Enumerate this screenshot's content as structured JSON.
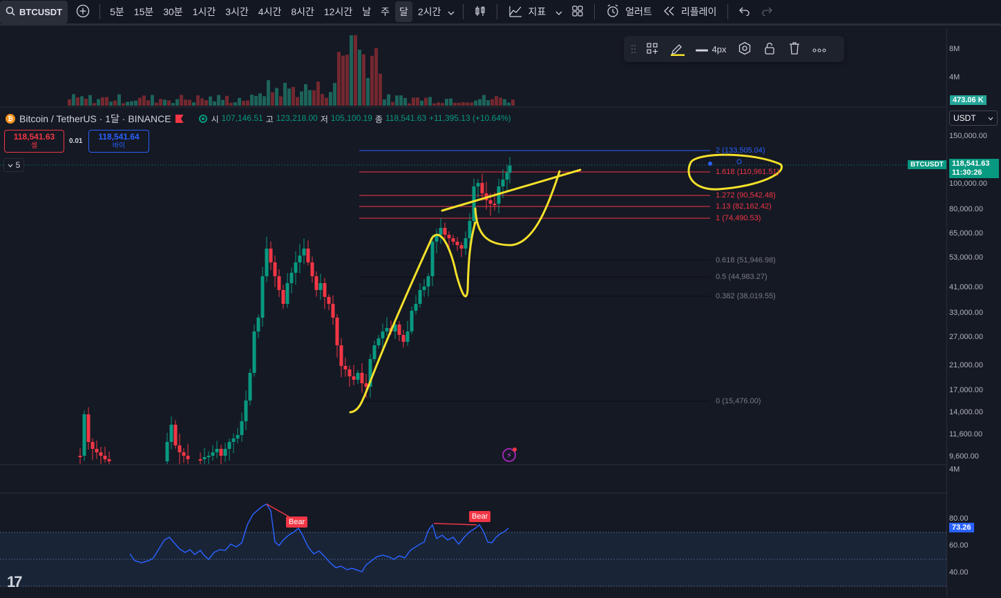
{
  "toolbar": {
    "symbol": "BTCUSDT",
    "intervals": [
      "5분",
      "15분",
      "30분",
      "1시간",
      "3시간",
      "4시간",
      "8시간",
      "12시간",
      "날",
      "주",
      "달",
      "2시간"
    ],
    "active_interval": "달",
    "indicators_label": "지표",
    "alert_label": "얼러트",
    "replay_label": "리플레이"
  },
  "draw_toolbar": {
    "width_label": "4px",
    "highlight_color": "#f5e12a"
  },
  "legend": {
    "title": "Bitcoin / TetherUS · 1달 · BINANCE",
    "open_key": "시",
    "open": "107,146.51",
    "high_key": "고",
    "high": "123,218.00",
    "low_key": "저",
    "low": "105,100.19",
    "close_key": "종",
    "close": "118,541.63",
    "change": "+11,395.13 (+10.64%)"
  },
  "trade": {
    "sell_price": "118,541.63",
    "sell_label": "셀",
    "spread": "0.01",
    "buy_price": "118,541.64",
    "buy_label": "바이"
  },
  "collapse": {
    "count": "5"
  },
  "currency": "USDT",
  "price_axis": {
    "volume_ticks": [
      "8M",
      "4M"
    ],
    "volume_badge": "473.06 K",
    "price_ticks": [
      "150,000.00",
      "100,000.00",
      "80,000.00",
      "65,000.00",
      "53,000.00",
      "41,000.00",
      "33,000.00",
      "27,000.00",
      "21,000.00",
      "17,000.00",
      "14,000.00",
      "11,600.00",
      "9,600.00"
    ],
    "price_badge_symbol": "BTCUSDT",
    "price_badge": "118,541.63",
    "countdown": "11:30:26",
    "lower_volume_tick": "4M",
    "rsi_ticks": [
      "80.00",
      "60.00",
      "40.00"
    ],
    "rsi_badge": "73.26"
  },
  "fib_levels": [
    {
      "label": "2 (133,505.04)",
      "color": "#2962ff"
    },
    {
      "label": "1.618 (110,961.51)",
      "color": "#f23645"
    },
    {
      "label": "1.272 (90,542.48)",
      "color": "#f23645"
    },
    {
      "label": "1.13 (82,162.42)",
      "color": "#f23645"
    },
    {
      "label": "1 (74,490.53)",
      "color": "#f23645"
    },
    {
      "label": "0.618 (51,946.98)",
      "color": "#787b86"
    },
    {
      "label": "0.5 (44,983.27)",
      "color": "#787b86"
    },
    {
      "label": "0.382 (38,019.55)",
      "color": "#787b86"
    },
    {
      "label": "0 (15,476.00)",
      "color": "#787b86"
    }
  ],
  "rsi": {
    "bear_label_1": "Bear",
    "bear_label_2": "Bear"
  },
  "colors": {
    "up": "#089981",
    "down": "#f23645",
    "rsi_line": "#2962ff",
    "background": "#151924"
  }
}
